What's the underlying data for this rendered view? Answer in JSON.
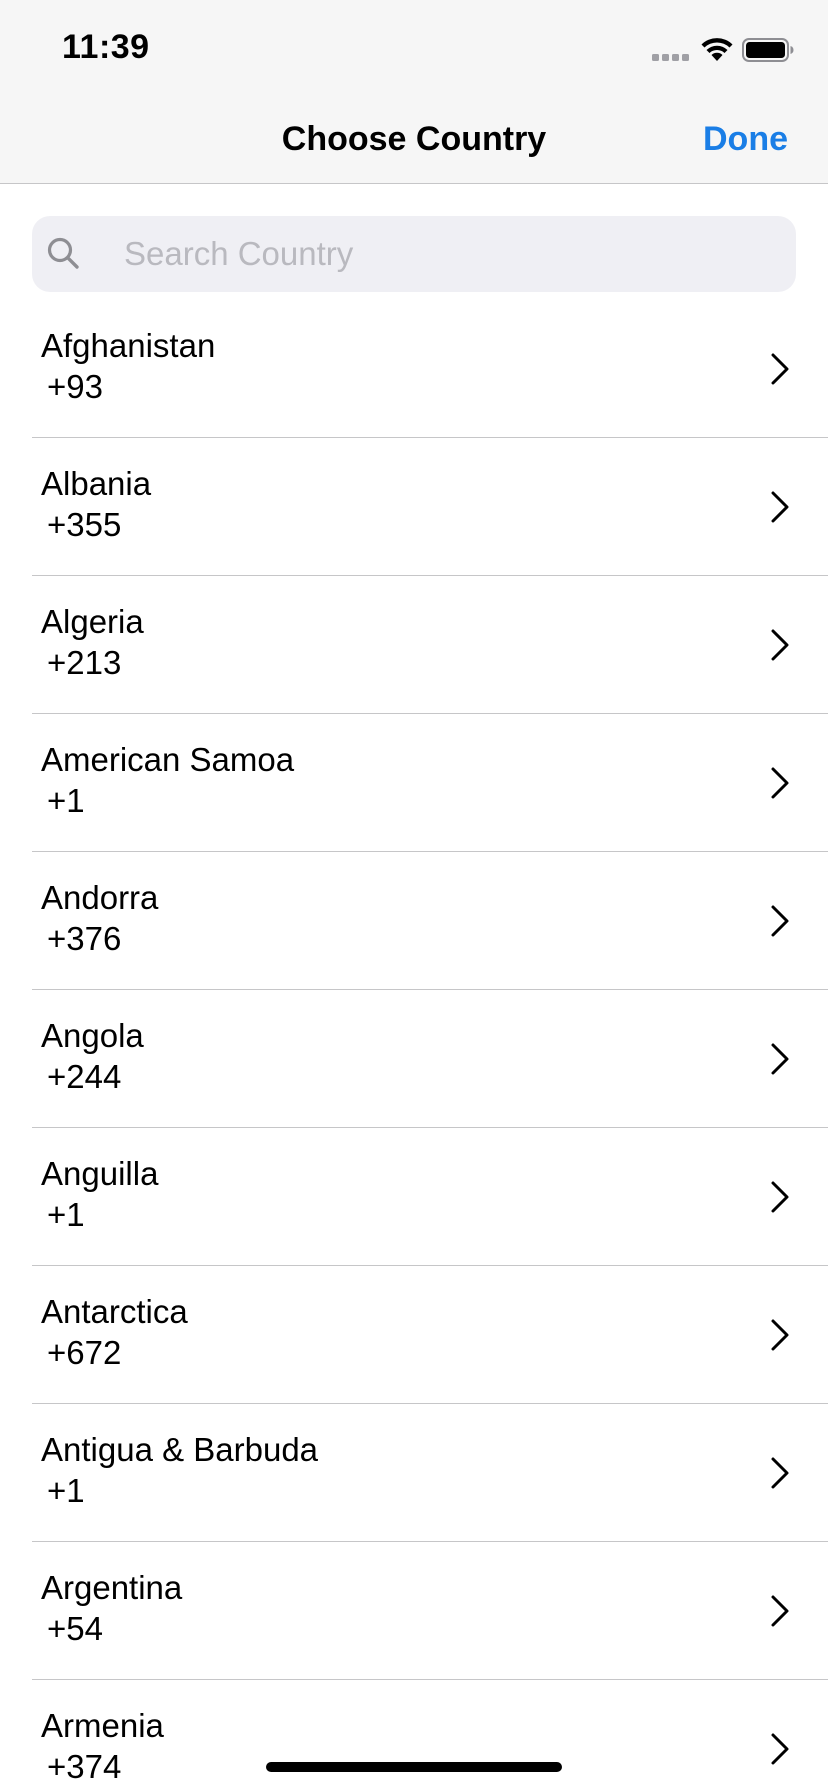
{
  "status_bar": {
    "time": "11:39"
  },
  "nav": {
    "title": "Choose Country",
    "done_label": "Done",
    "accent_color": "#1a7ee6"
  },
  "search": {
    "placeholder": "Search Country",
    "value": ""
  },
  "icons": {
    "search": "search-icon",
    "chevron": "chevron-right-icon",
    "wifi": "wifi-icon",
    "battery": "battery-icon",
    "signal": "signal-icon"
  },
  "countries": [
    {
      "name": "Afghanistan",
      "code": "+93"
    },
    {
      "name": "Albania",
      "code": "+355"
    },
    {
      "name": "Algeria",
      "code": "+213"
    },
    {
      "name": "American Samoa",
      "code": "+1"
    },
    {
      "name": "Andorra",
      "code": "+376"
    },
    {
      "name": "Angola",
      "code": "+244"
    },
    {
      "name": "Anguilla",
      "code": "+1"
    },
    {
      "name": "Antarctica",
      "code": "+672"
    },
    {
      "name": "Antigua & Barbuda",
      "code": "+1"
    },
    {
      "name": "Argentina",
      "code": "+54"
    },
    {
      "name": "Armenia",
      "code": "+374"
    }
  ]
}
